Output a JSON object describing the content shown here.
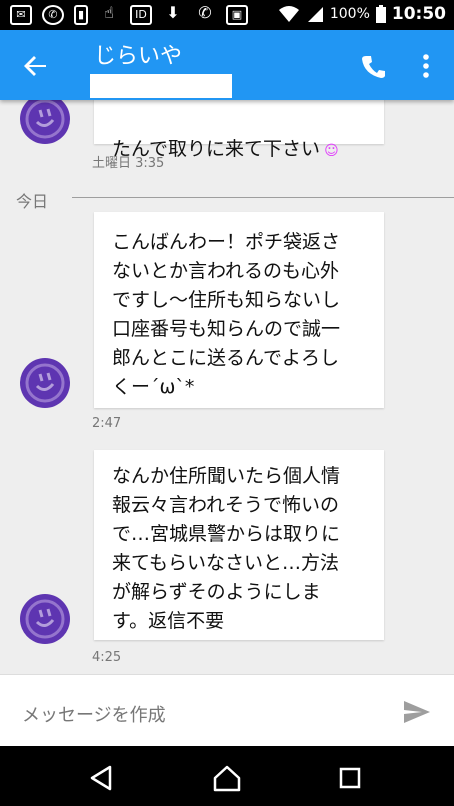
{
  "status_bar": {
    "battery_percent": "100%",
    "time": "10:50",
    "left_icons": [
      "mail-icon",
      "phone-circle-icon",
      "sim-icon",
      "hand-icon",
      "id-icon",
      "download-icon",
      "missed-call-icon",
      "image-icon"
    ],
    "right_icons": [
      "wifi-icon",
      "signal-icon",
      "battery-icon"
    ]
  },
  "app_bar": {
    "title": "じらいや",
    "subtitle": "",
    "accent_color": "#2196f3"
  },
  "conversation": {
    "messages": [
      {
        "text": "たんで取りに来て下さい",
        "emoji": "☺",
        "time": "土曜日 3:35"
      },
      {
        "text": "こんばんわー！ポチ袋返さ\nないとか言われるのも心外\nですし〜住所も知らないし\n口座番号も知らんので誠一\n郎んとこに送るんでよろし\nくー´ω`*",
        "time": "2:47"
      },
      {
        "text": "なんか住所聞いたら個人情\n報云々言われそうで怖いの\nで…宮城県警からは取りに\n来てもらいなさいと…方法\nが解らずそのようにしま\nす。返信不要",
        "time": "4:25"
      }
    ],
    "day_separator": "今日"
  },
  "composer": {
    "placeholder": "メッセージを作成"
  },
  "colors": {
    "avatar": "#5e35b1",
    "background": "#eeeeee"
  }
}
